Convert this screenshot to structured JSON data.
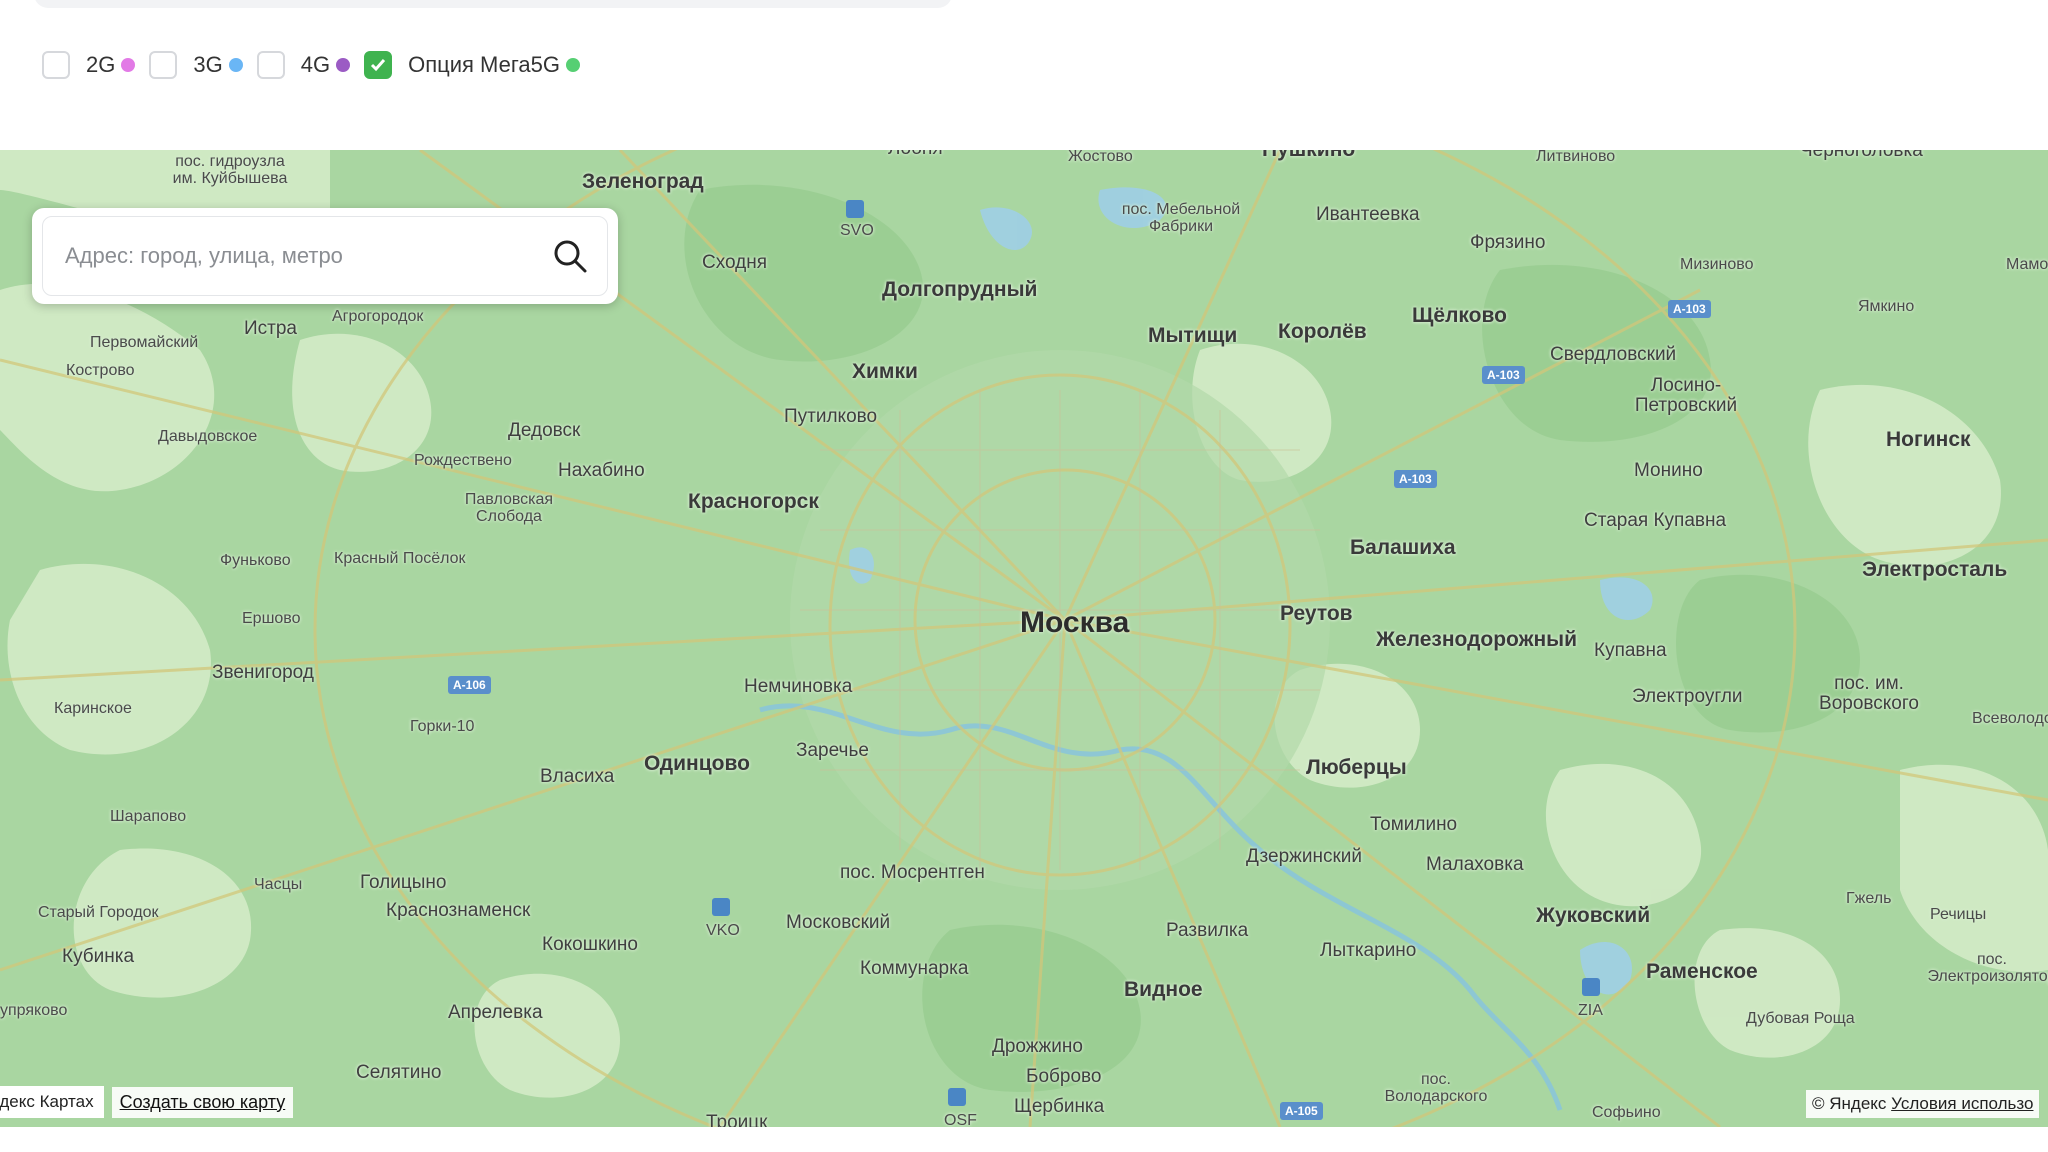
{
  "filters": [
    {
      "label": "2G",
      "checked": false,
      "dot_color": "#e27ae6"
    },
    {
      "label": "3G",
      "checked": false,
      "dot_color": "#6ab6f5"
    },
    {
      "label": "4G",
      "checked": false,
      "dot_color": "#9b5bc4"
    },
    {
      "label": "Опция Мега5G",
      "checked": true,
      "dot_color": "#56cf73"
    }
  ],
  "search": {
    "placeholder": "Адрес: город, улица, метро"
  },
  "map": {
    "places": {
      "moscow": "Москва",
      "zelenograd": "Зеленоград",
      "khimki": "Химки",
      "dolgoprudny": "Долгопрудный",
      "mytishchi": "Мытищи",
      "korolev": "Королёв",
      "shchelkovo": "Щёлково",
      "ivanteevka": "Ивантеевка",
      "fryazino": "Фрязино",
      "pushkino": "Пушкино",
      "krasnogorsk": "Красногорск",
      "odintsovo": "Одинцово",
      "balashikha": "Балашиха",
      "reutov": "Реутов",
      "zheleznodorozhny": "Железнодорожный",
      "lyubertsy": "Люберцы",
      "vidnoe": "Видное",
      "zhukovsky": "Жуковский",
      "ramenskoe": "Раменское",
      "noginsk": "Ногинск",
      "elektrostal": "Электросталь",
      "skhodnya": "Сходня",
      "putilkovo": "Путилково",
      "nakhabino": "Нахабино",
      "dedovsk": "Дедовск",
      "istra": "Истра",
      "zvenigorod": "Звенигород",
      "nemchinovka": "Немчиновка",
      "zarechye": "Заречье",
      "vlasikha": "Власиха",
      "golitsyno": "Голицыно",
      "krasnoznamensk": "Краснознаменск",
      "kokoshkino": "Кокошкино",
      "moskovsky": "Московский",
      "kommunarka": "Коммунарка",
      "mosrentgen": "пос. Мосрентген",
      "aprelevka": "Апрелевка",
      "selyatino": "Селятино",
      "kubinka": "Кубинка",
      "drozhzhino": "Дрожжино",
      "bobrovo": "Боброво",
      "shcherbinka": "Щербинка",
      "troitsk": "Троицк",
      "razvilka": "Развилка",
      "dzerzhinsky": "Дзержинский",
      "lytkarino": "Лыткарино",
      "tomilino": "Томилино",
      "malakhovka": "Малаховка",
      "kupavna": "Купавна",
      "elektrougli": "Электроугли",
      "staraya_kupavna": "Старая Купавна",
      "monino": "Монино",
      "losino": "Лосино-Петровский",
      "sverdlovsky": "Свердловский",
      "mizinovo": "Мизиново",
      "yamkino": "Ямкино",
      "litvinovo": "Литвиново",
      "chernogolovka": "Черноголовка",
      "vorovskogo": "пос. им. Воровского",
      "gzhel": "Гжель",
      "rechitsy": "Речицы",
      "dubovaya_roshcha": "Дубовая Роща",
      "sofyino": "Софьино",
      "volodarskogo": "пос. Володарского",
      "mebelnoy": "пос. Мебельной Фабрики",
      "zhostovo": "Жостово",
      "lozhki": "Лобня",
      "gidrouzla": "пос. гидроузла им. Куйбышева",
      "agrogorodok": "Агрогородок",
      "pervomaysky": "Первомайский",
      "kostrovo": "Кострово",
      "davydovskoe": "Давыдовское",
      "rozhdestveno": "Рождествено",
      "pavlovskaya": "Павловская Слобода",
      "krasny_posyolok": "Красный Посёлок",
      "funkovo": "Фуньково",
      "ershovo": "Ершово",
      "karinskoe": "Каринское",
      "gorki10": "Горки-10",
      "sharapovo": "Шарапово",
      "chasy": "Часцы",
      "stary_gorodok": "Старый Городок",
      "elektrozavod": "пос. Электроизолятор",
      "vsevolod": "Всеволодово",
      "mamo": "Мамо",
      "tupryakovo": "упряково",
      "sheremetyevo": "SVO",
      "vnukovo": "VKO",
      "zhukovsky_air": "ZIA",
      "ostafyevo": "OSF"
    },
    "roads": {
      "a103_1": "A-103",
      "a103_2": "A-103",
      "a103_3": "A-103",
      "a106": "A-106",
      "a105": "A-105"
    },
    "attribution_left": "ндекс Картах",
    "create_map": "Создать свою карту",
    "copyright": "© Яндекс",
    "terms": "Условия использо"
  }
}
